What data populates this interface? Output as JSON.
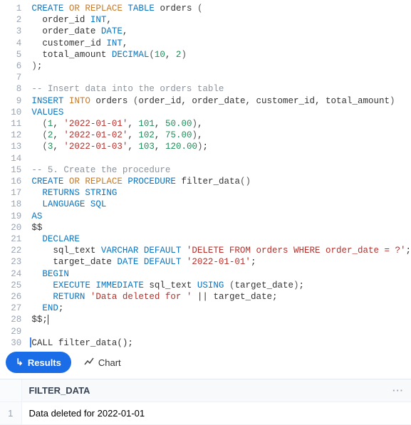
{
  "code_lines": [
    [
      [
        "kw",
        "CREATE"
      ],
      [
        " "
      ],
      [
        "kw2",
        "OR"
      ],
      [
        " "
      ],
      [
        "kw2",
        "REPLACE"
      ],
      [
        " "
      ],
      [
        "kw",
        "TABLE"
      ],
      [
        " "
      ],
      [
        "ident",
        "orders"
      ],
      [
        " "
      ],
      [
        "paren",
        "("
      ]
    ],
    [
      [
        "  "
      ],
      [
        "ident",
        "order_id"
      ],
      [
        " "
      ],
      [
        "kw",
        "INT"
      ],
      [
        "ident",
        ","
      ]
    ],
    [
      [
        "  "
      ],
      [
        "ident",
        "order_date"
      ],
      [
        " "
      ],
      [
        "kw",
        "DATE"
      ],
      [
        "ident",
        ","
      ]
    ],
    [
      [
        "  "
      ],
      [
        "ident",
        "customer_id"
      ],
      [
        " "
      ],
      [
        "kw",
        "INT"
      ],
      [
        "ident",
        ","
      ]
    ],
    [
      [
        "  "
      ],
      [
        "ident",
        "total_amount"
      ],
      [
        " "
      ],
      [
        "kw",
        "DECIMAL"
      ],
      [
        "paren",
        "("
      ],
      [
        "num",
        "10"
      ],
      [
        "ident",
        ", "
      ],
      [
        "num",
        "2"
      ],
      [
        "paren",
        ")"
      ]
    ],
    [
      [
        "paren",
        ")"
      ],
      [
        "ident",
        ";"
      ]
    ],
    [],
    [
      [
        "comm",
        "-- Insert data into the orders table"
      ]
    ],
    [
      [
        "kw",
        "INSERT"
      ],
      [
        " "
      ],
      [
        "kw2",
        "INTO"
      ],
      [
        " "
      ],
      [
        "ident",
        "orders"
      ],
      [
        " "
      ],
      [
        "paren",
        "("
      ],
      [
        "ident",
        "order_id, order_date, customer_id, total_amount"
      ],
      [
        "paren",
        ")"
      ]
    ],
    [
      [
        "kw",
        "VALUES"
      ]
    ],
    [
      [
        "  "
      ],
      [
        "paren",
        "("
      ],
      [
        "num",
        "1"
      ],
      [
        "ident",
        ", "
      ],
      [
        "str",
        "'2022-01-01'"
      ],
      [
        "ident",
        ", "
      ],
      [
        "num",
        "101"
      ],
      [
        "ident",
        ", "
      ],
      [
        "num",
        "50.00"
      ],
      [
        "paren",
        ")"
      ],
      [
        "ident",
        ","
      ]
    ],
    [
      [
        "  "
      ],
      [
        "paren",
        "("
      ],
      [
        "num",
        "2"
      ],
      [
        "ident",
        ", "
      ],
      [
        "str",
        "'2022-01-02'"
      ],
      [
        "ident",
        ", "
      ],
      [
        "num",
        "102"
      ],
      [
        "ident",
        ", "
      ],
      [
        "num",
        "75.00"
      ],
      [
        "paren",
        ")"
      ],
      [
        "ident",
        ","
      ]
    ],
    [
      [
        "  "
      ],
      [
        "paren",
        "("
      ],
      [
        "num",
        "3"
      ],
      [
        "ident",
        ", "
      ],
      [
        "str",
        "'2022-01-03'"
      ],
      [
        "ident",
        ", "
      ],
      [
        "num",
        "103"
      ],
      [
        "ident",
        ", "
      ],
      [
        "num",
        "120.00"
      ],
      [
        "paren",
        ")"
      ],
      [
        "ident",
        ";"
      ]
    ],
    [],
    [
      [
        "comm",
        "-- 5. Create the procedure"
      ]
    ],
    [
      [
        "kw",
        "CREATE"
      ],
      [
        " "
      ],
      [
        "kw2",
        "OR"
      ],
      [
        " "
      ],
      [
        "kw2",
        "REPLACE"
      ],
      [
        " "
      ],
      [
        "kw",
        "PROCEDURE"
      ],
      [
        " "
      ],
      [
        "ident",
        "filter_data"
      ],
      [
        "paren",
        "()"
      ]
    ],
    [
      [
        "  "
      ],
      [
        "kw",
        "RETURNS"
      ],
      [
        " "
      ],
      [
        "kw",
        "STRING"
      ]
    ],
    [
      [
        "  "
      ],
      [
        "kw",
        "LANGUAGE"
      ],
      [
        " "
      ],
      [
        "kw",
        "SQL"
      ]
    ],
    [
      [
        "kw",
        "AS"
      ]
    ],
    [
      [
        "ident",
        "$$"
      ]
    ],
    [
      [
        "  "
      ],
      [
        "kw",
        "DECLARE"
      ]
    ],
    [
      [
        "    "
      ],
      [
        "ident",
        "sql_text"
      ],
      [
        " "
      ],
      [
        "kw",
        "VARCHAR"
      ],
      [
        " "
      ],
      [
        "kw",
        "DEFAULT"
      ],
      [
        " "
      ],
      [
        "str",
        "'DELETE FROM orders WHERE order_date = ?'"
      ],
      [
        "ident",
        ";"
      ]
    ],
    [
      [
        "    "
      ],
      [
        "ident",
        "target_date"
      ],
      [
        " "
      ],
      [
        "kw",
        "DATE"
      ],
      [
        " "
      ],
      [
        "kw",
        "DEFAULT"
      ],
      [
        " "
      ],
      [
        "str",
        "'2022-01-01'"
      ],
      [
        "ident",
        ";"
      ]
    ],
    [
      [
        "  "
      ],
      [
        "kw",
        "BEGIN"
      ]
    ],
    [
      [
        "    "
      ],
      [
        "kw",
        "EXECUTE"
      ],
      [
        " "
      ],
      [
        "kw",
        "IMMEDIATE"
      ],
      [
        " "
      ],
      [
        "ident",
        "sql_text"
      ],
      [
        " "
      ],
      [
        "kw",
        "USING"
      ],
      [
        " "
      ],
      [
        "paren",
        "("
      ],
      [
        "ident",
        "target_date"
      ],
      [
        "paren",
        ")"
      ],
      [
        "ident",
        ";"
      ]
    ],
    [
      [
        "    "
      ],
      [
        "kw",
        "RETURN"
      ],
      [
        " "
      ],
      [
        "str",
        "'Data deleted for '"
      ],
      [
        " "
      ],
      [
        "ident",
        "||"
      ],
      [
        " "
      ],
      [
        "ident",
        "target_date;"
      ]
    ],
    [
      [
        "  "
      ],
      [
        "kw",
        "END"
      ],
      [
        "ident",
        ";"
      ]
    ],
    [
      [
        "ident",
        "$$;"
      ]
    ],
    [],
    [
      [
        "ident",
        "CALL filter_data();"
      ]
    ]
  ],
  "cursor_line": 30,
  "caret_after_line": 28,
  "bottom": {
    "results_label": "Results",
    "chart_label": "Chart"
  },
  "table": {
    "column": "FILTER_DATA",
    "menu_glyph": "···",
    "rows": [
      {
        "n": "1",
        "v": "Data deleted for 2022-01-01"
      }
    ]
  }
}
